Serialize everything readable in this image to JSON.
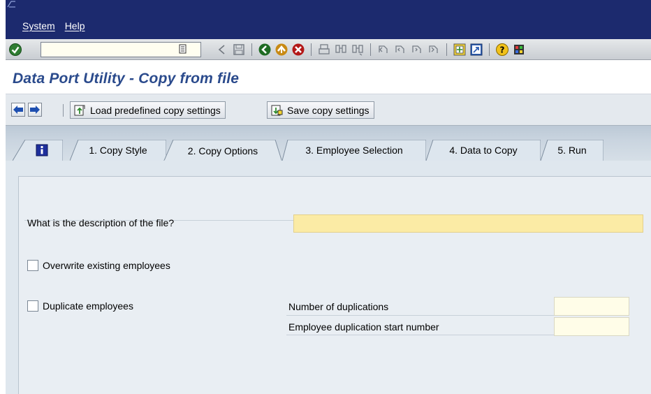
{
  "menubar": {
    "items": [
      "System",
      "Help"
    ]
  },
  "toolbar": {
    "command_field": {
      "value": "",
      "placeholder": ""
    },
    "icons": [
      "back-arrow-icon",
      "save-icon",
      "back-icon",
      "exit-icon",
      "cancel-icon",
      "print-icon",
      "find-icon",
      "find-next-icon",
      "first-page-icon",
      "previous-page-icon",
      "next-page-icon",
      "last-page-icon",
      "create-session-icon",
      "shortcut-icon",
      "help-icon",
      "customize-layout-icon"
    ]
  },
  "title": "Data Port Utility - Copy from file",
  "app_toolbar": {
    "load_label": "Load predefined copy settings",
    "save_label": "Save copy settings"
  },
  "tabs": [
    {
      "label": "",
      "icon": "info-icon",
      "active": false
    },
    {
      "label": "1. Copy Style",
      "active": false
    },
    {
      "label": "2. Copy Options",
      "active": true
    },
    {
      "label": "3. Employee Selection",
      "active": false
    },
    {
      "label": "4. Data to Copy",
      "active": false
    },
    {
      "label": "5. Run",
      "active": false
    }
  ],
  "form": {
    "description_label": "What is the description of the file?",
    "description_value": "",
    "overwrite_label": "Overwrite existing employees",
    "overwrite_checked": false,
    "duplicate_label": "Duplicate employees",
    "duplicate_checked": false,
    "num_duplications_label": "Number of duplications",
    "num_duplications_value": "",
    "start_number_label": "Employee duplication start number",
    "start_number_value": ""
  },
  "colors": {
    "menubar": "#1c2a6e",
    "title": "#2a4a8c",
    "required_field": "#fbeba5",
    "panel": "#e9eef3"
  }
}
